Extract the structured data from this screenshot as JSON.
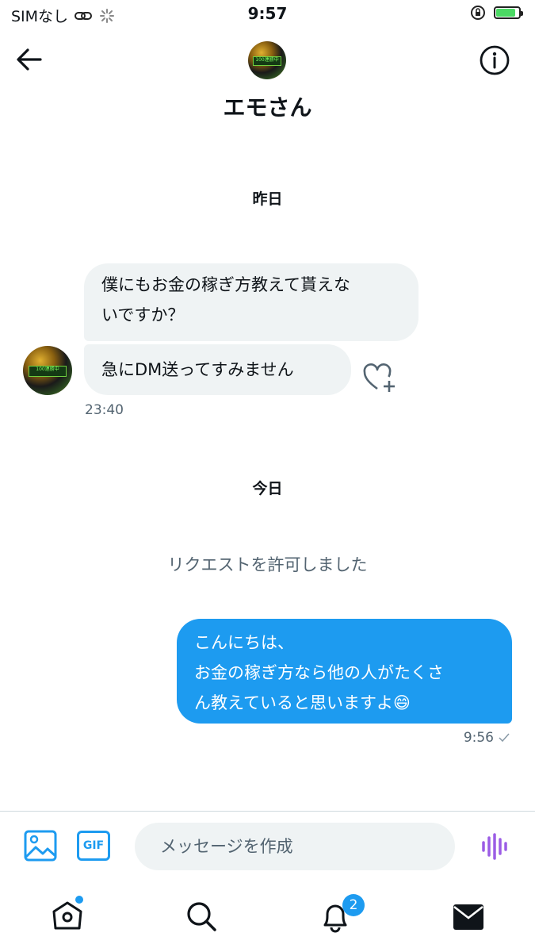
{
  "status_bar": {
    "carrier": "SIMなし",
    "time": "9:57",
    "battery_color": "#4cd964"
  },
  "header": {
    "contact_name": "エモさん",
    "avatar_text": "100連勝中",
    "back_icon": "arrow-left-icon",
    "info_icon": "info-circle-icon"
  },
  "conversation": {
    "yesterday_label": "昨日",
    "incoming_message_1_line_1": "僕にもお金の稼ぎ方教えて貰えな",
    "incoming_message_1_line_2": "いですか？",
    "incoming_message_2": "急にDM送ってすみません",
    "incoming_time": "23:40",
    "today_label": "今日",
    "system_message": "リクエストを許可しました",
    "outgoing_line_1": "こんにちは、",
    "outgoing_line_2": "お金の稼ぎ方なら他の人がたくさ",
    "outgoing_line_3": "ん教えていると思いますよ😄",
    "outgoing_time": "9:56"
  },
  "composer": {
    "placeholder": "メッセージを作成",
    "gif_label": "GIF",
    "accent_color": "#1d9bf0",
    "voice_color": "#9b5de5"
  },
  "tab_bar": {
    "notification_count": "2",
    "items": [
      "home-icon",
      "search-icon",
      "bell-icon",
      "mail-icon"
    ]
  }
}
